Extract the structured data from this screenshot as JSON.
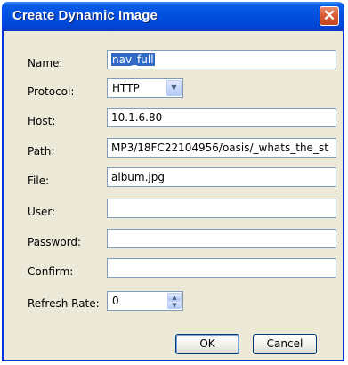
{
  "window": {
    "title": "Create Dynamic Image",
    "close_glyph": "✕"
  },
  "form": {
    "name": {
      "label": "Name:",
      "value": "nav_full"
    },
    "protocol": {
      "label": "Protocol:",
      "value": "HTTP"
    },
    "host": {
      "label": "Host:",
      "value": "10.1.6.80"
    },
    "path": {
      "label": "Path:",
      "value": "MP3/18FC22104956/oasis/_whats_the_st"
    },
    "file": {
      "label": "File:",
      "value": "album.jpg"
    },
    "user": {
      "label": "User:",
      "value": ""
    },
    "password": {
      "label": "Password:",
      "value": ""
    },
    "confirm": {
      "label": "Confirm:",
      "value": ""
    },
    "refresh_rate": {
      "label": "Refresh Rate:",
      "value": "0"
    }
  },
  "buttons": {
    "ok": "OK",
    "cancel": "Cancel"
  },
  "icons": {
    "dropdown": "chevron-down-icon",
    "spin_up": "spin-up-icon",
    "spin_down": "spin-down-icon",
    "close": "close-icon"
  }
}
